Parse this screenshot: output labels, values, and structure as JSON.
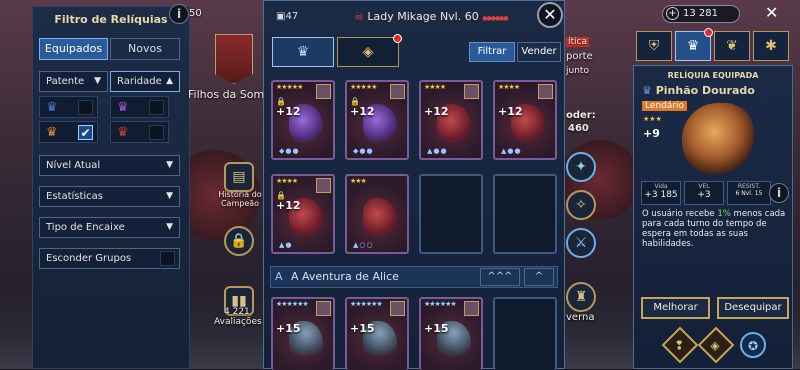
{
  "filter": {
    "title": "Filtro de Relíquias",
    "info_icon": "i",
    "tabs": [
      "Equipados",
      "Novos"
    ],
    "sort": [
      {
        "label": "Patente",
        "active": false
      },
      {
        "label": "Raridade",
        "active": true
      }
    ],
    "grid": [
      {
        "icon": "crown-icon",
        "color": "#4a7ad8",
        "checked": false
      },
      {
        "icon": "crown-icon",
        "color": "#b050d0",
        "checked": false
      },
      {
        "icon": "crown-icon",
        "color": "#e08a30",
        "checked": true
      },
      {
        "icon": "crown-icon",
        "color": "#d03a3a",
        "checked": false
      }
    ],
    "dropdowns": [
      "Nível Atual",
      "Estatísticas",
      "Tipo de Encaixe"
    ],
    "hide_groups": "Esconder Grupos",
    "counter_peek": "50"
  },
  "background": {
    "clan_name": "Filhos da Somb",
    "history": "História do Campeão",
    "reviews_count": "4 221",
    "reviews_label": "Avaliações",
    "peek_texts": [
      "ítica",
      "porte",
      "junto",
      "oder:",
      "460",
      "verna"
    ]
  },
  "inventory": {
    "count": "47",
    "champion": "Lady Mikage Nvl. 60",
    "filter_button": "Filtrar",
    "sell_button": "Vender",
    "relics": [
      {
        "level": "+12",
        "stars": "★★★★★",
        "art": "purple",
        "sets": "◆●●"
      },
      {
        "level": "+12",
        "stars": "★★★★★",
        "art": "purple",
        "sets": "◆●●"
      },
      {
        "level": "+12",
        "stars": "★★★★",
        "art": "red",
        "sets": "▲●●"
      },
      {
        "level": "+12",
        "stars": "★★★★",
        "art": "red",
        "sets": "▲●●"
      },
      {
        "level": "+12",
        "stars": "★★★★",
        "art": "red",
        "sets": "▲●"
      },
      {
        "level": "",
        "stars": "★★★",
        "art": "red",
        "sets": "▲○○"
      }
    ],
    "section": {
      "label": "A Aventura de Alice",
      "icon": "A",
      "collapse": "^^^",
      "toggle": "^"
    },
    "relics2": [
      {
        "level": "+15",
        "stars": "★★★★★★",
        "art": "mace"
      },
      {
        "level": "+15",
        "stars": "★★★★★★",
        "art": "mace"
      },
      {
        "level": "+15",
        "stars": "★★★★★★",
        "art": "mace"
      }
    ]
  },
  "currency": "13 281",
  "relic_panel": {
    "header": "RELÍQUIA EQUIPADA",
    "name": "Pinhão Dourado",
    "rarity": "Lendário",
    "rarity_color": "#e0782a",
    "stars": "★★★",
    "level": "+9",
    "stats": [
      {
        "name": "Vida",
        "value": "+3 185"
      },
      {
        "name": "VEL",
        "value": "+3"
      },
      {
        "name": "RESIST.",
        "value": "6 Nvl. 15"
      }
    ],
    "description_parts": [
      "O usuário recebe ",
      "1%",
      " menos cada para cada turno do tempo de espera em todas as suas habilidades."
    ],
    "upgrade": "Melhorar",
    "unequip": "Desequipar"
  }
}
